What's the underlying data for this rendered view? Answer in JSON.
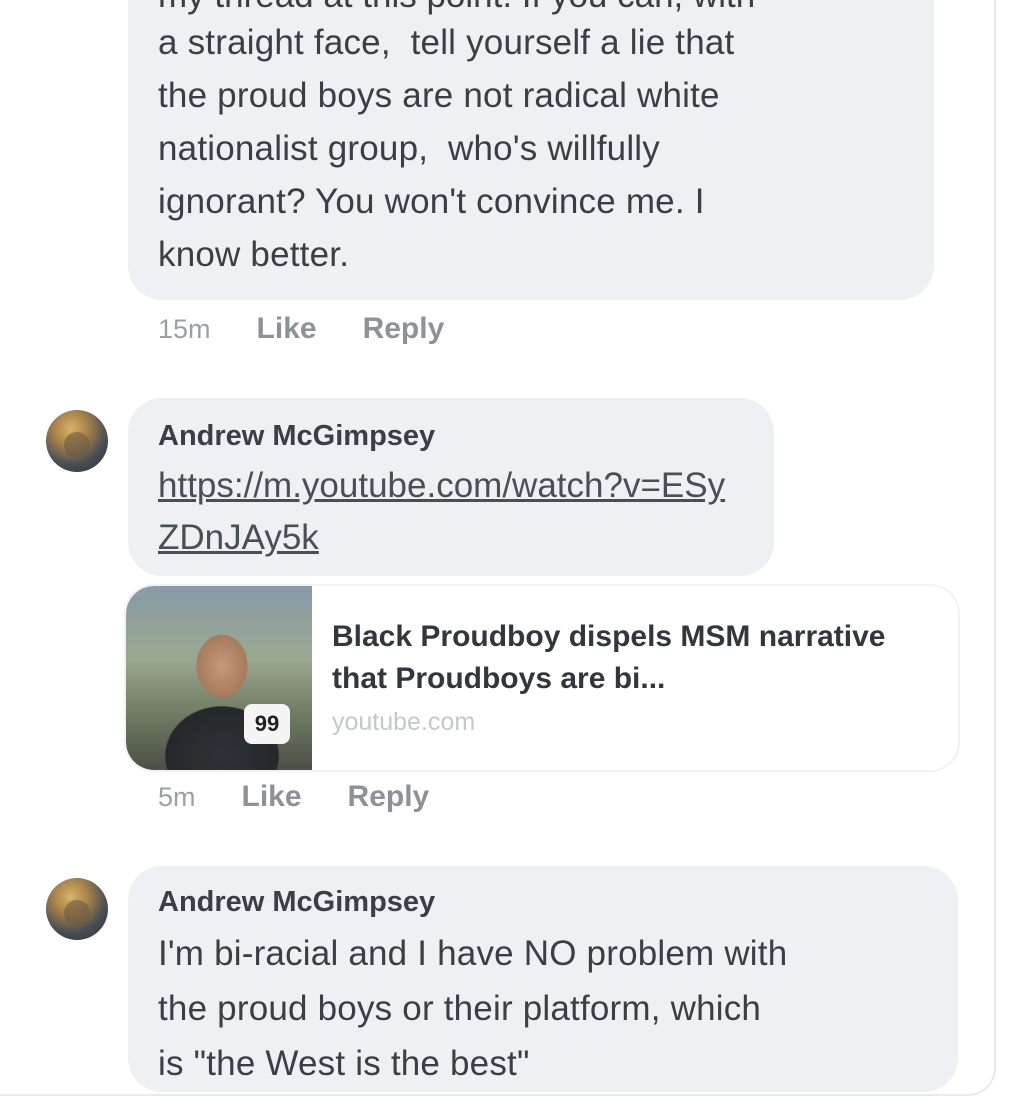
{
  "comments": [
    {
      "clipped_line": "my thread at this point. If you can, with",
      "text": "a straight face,  tell yourself a lie that\nthe proud boys are not radical white\nnationalist group,  who's willfully\nignorant? You won't convince me. I\nknow better.",
      "time": "15m",
      "like_label": "Like",
      "reply_label": "Reply"
    },
    {
      "author": "Andrew McGimpsey",
      "link": "https://m.youtube.com/watch?v=ESyZDnJAy5k",
      "preview": {
        "title": "Black Proudboy dispels MSM narrative that Proudboys are bi...",
        "domain": "youtube.com",
        "thumbnail_badge": "99"
      },
      "time": "5m",
      "like_label": "Like",
      "reply_label": "Reply"
    },
    {
      "author": "Andrew McGimpsey",
      "text": "I'm bi-racial and I have NO problem with\nthe proud boys or their platform, which\nis \"the West is the best\""
    }
  ]
}
